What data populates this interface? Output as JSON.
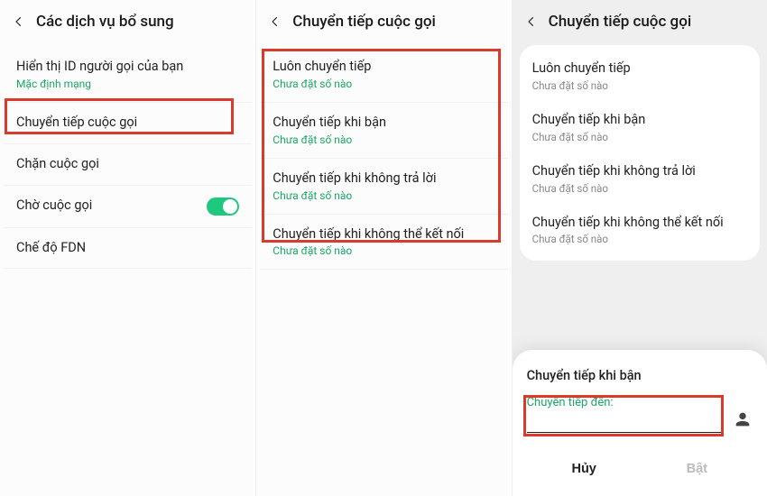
{
  "panel1": {
    "title": "Các dịch vụ bổ sung",
    "items": [
      {
        "label": "Hiển thị ID người gọi của bạn",
        "sub": "Mặc định mạng",
        "subcolor": "green"
      },
      {
        "label": "Chuyển tiếp cuộc gọi"
      },
      {
        "label": "Chặn cuộc gọi"
      },
      {
        "label": "Chờ cuộc gọi",
        "toggle": true
      },
      {
        "label": "Chế độ FDN"
      }
    ]
  },
  "panel2": {
    "title": "Chuyển tiếp cuộc gọi",
    "items": [
      {
        "label": "Luôn chuyển tiếp",
        "sub": "Chưa đặt số nào"
      },
      {
        "label": "Chuyển tiếp khi bận",
        "sub": "Chưa đặt số nào"
      },
      {
        "label": "Chuyển tiếp khi không trả lời",
        "sub": "Chưa đặt số nào"
      },
      {
        "label": "Chuyển tiếp khi không thể kết nối",
        "sub": "Chưa đặt số nào"
      }
    ]
  },
  "panel3": {
    "title": "Chuyển tiếp cuộc gọi",
    "items": [
      {
        "label": "Luôn chuyển tiếp",
        "sub": "Chưa đặt số nào"
      },
      {
        "label": "Chuyển tiếp khi bận",
        "sub": "Chưa đặt số nào"
      },
      {
        "label": "Chuyển tiếp khi không trả lời",
        "sub": "Chưa đặt số nào"
      },
      {
        "label": "Chuyển tiếp khi không thể kết nối",
        "sub": "Chưa đặt số nào"
      }
    ],
    "sheet": {
      "title": "Chuyển tiếp khi bận",
      "field_label": "Chuyển tiếp đến:",
      "cancel": "Hủy",
      "enable": "Bật"
    }
  }
}
